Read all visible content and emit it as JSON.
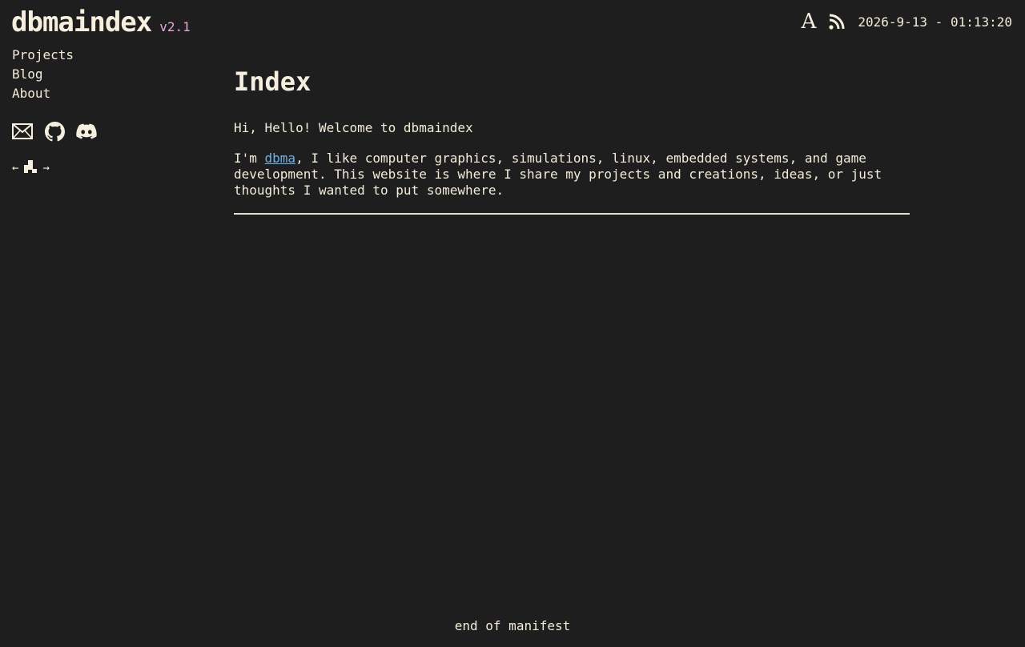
{
  "header": {
    "brand": "dbmaindex",
    "version": "v2.1",
    "font_toggle_label": "A",
    "clock": "2026-9-13 - 01:13:20"
  },
  "sidebar": {
    "nav": [
      {
        "label": "Projects"
      },
      {
        "label": "Blog"
      },
      {
        "label": "About"
      }
    ],
    "social_icons": [
      "mail-icon",
      "github-icon",
      "discord-icon"
    ],
    "webring": {
      "prev": "←",
      "next": "→",
      "icon": "webring-logo-icon"
    }
  },
  "main": {
    "title": "Index",
    "greeting": "Hi, Hello! Welcome to dbmaindex",
    "intro_prefix": "I'm ",
    "intro_link": "dbma",
    "intro_suffix": ", I like computer graphics, simulations, linux, embedded systems, and game development. This website is where I share my projects and creations, ideas, or just thoughts I wanted to put somewhere."
  },
  "footer": {
    "text": "end of manifest"
  },
  "colors": {
    "background": "#1e1e1e",
    "text": "#f3ecd8",
    "version_accent": "#e7a6d8",
    "link": "#6db3e8"
  }
}
